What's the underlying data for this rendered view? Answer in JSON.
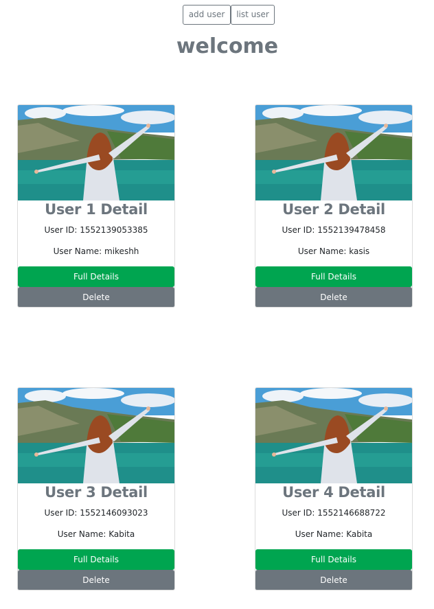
{
  "nav": {
    "add_user_label": "add user",
    "list_user_label": "list user"
  },
  "page": {
    "title": "welcome"
  },
  "theme": {
    "title_color": "#6c757d",
    "full_details_color": "#00a550",
    "delete_color": "#6c757d"
  },
  "cards": [
    {
      "title": "User 1 Detail",
      "id_label": "User ID: ",
      "id_value": "1552139053385",
      "name_label": "User Name: ",
      "name_value": "mikeshh",
      "full_details_label": "Full Details",
      "delete_label": "Delete",
      "image": "woman-arms-outstretched-at-lake-photo"
    },
    {
      "title": "User 2 Detail",
      "id_label": "User ID: ",
      "id_value": "1552139478458",
      "name_label": "User Name: ",
      "name_value": "kasis",
      "full_details_label": "Full Details",
      "delete_label": "Delete",
      "image": "woman-arms-outstretched-at-lake-photo"
    },
    {
      "title": "User 3 Detail",
      "id_label": "User ID: ",
      "id_value": "1552146093023",
      "name_label": "User Name: ",
      "name_value": "Kabita",
      "full_details_label": "Full Details",
      "delete_label": "Delete",
      "image": "woman-arms-outstretched-at-lake-photo"
    },
    {
      "title": "User 4 Detail",
      "id_label": "User ID: ",
      "id_value": "1552146688722",
      "name_label": "User Name: ",
      "name_value": "Kabita",
      "full_details_label": "Full Details",
      "delete_label": "Delete",
      "image": "woman-arms-outstretched-at-lake-photo"
    }
  ]
}
